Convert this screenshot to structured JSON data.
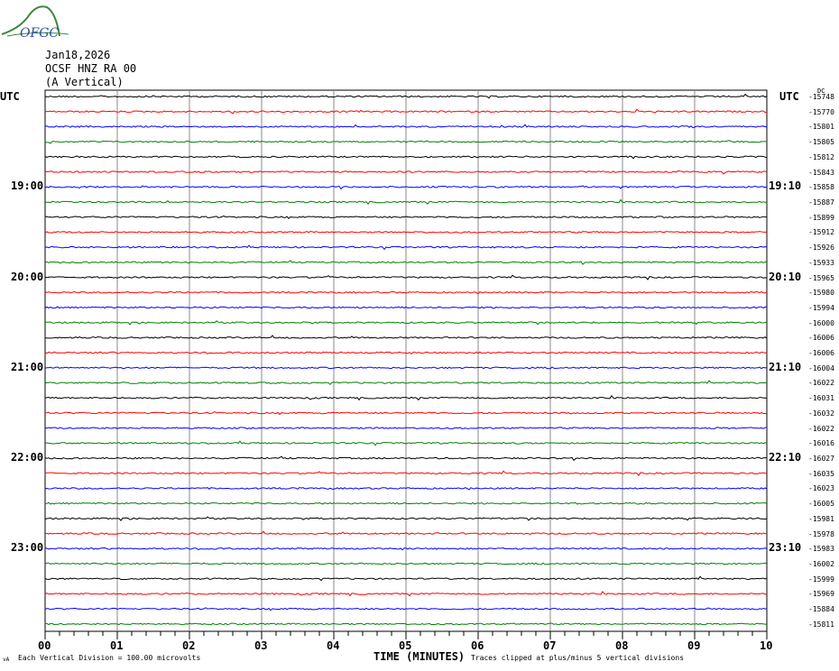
{
  "logo": {
    "text": "OFGC",
    "color": "#3a7a3a"
  },
  "header": {
    "date": "Jan18,2026",
    "station": "OCSF HNZ RA 00",
    "component": "(A Vertical)"
  },
  "left_top_label": "UTC",
  "right_top_label": "UTC",
  "dc_label": "DC",
  "footer": {
    "scale": "Each Vertical Division =  100.00 microvolts",
    "xlabel": "TIME (MINUTES)",
    "clip": "Traces clipped at plus/minus 5 vertical divisions",
    "corner": "vA"
  },
  "chart_data": {
    "type": "line",
    "title": "OCSF HNZ RA 00 (A Vertical) Jan18,2026",
    "xlabel": "TIME (MINUTES)",
    "xlim": [
      0,
      10
    ],
    "x_ticks": [
      "00",
      "01",
      "02",
      "03",
      "04",
      "05",
      "06",
      "07",
      "08",
      "09",
      "10"
    ],
    "trace_minutes": 10,
    "trace_colors": [
      "#000000",
      "#ff0000",
      "#0000ff",
      "#008000"
    ],
    "left_hour_labels": [
      {
        "trace": 6,
        "label": "19:00"
      },
      {
        "trace": 12,
        "label": "20:00"
      },
      {
        "trace": 18,
        "label": "21:00"
      },
      {
        "trace": 24,
        "label": "22:00"
      },
      {
        "trace": 30,
        "label": "23:00"
      }
    ],
    "right_hour_labels": [
      {
        "trace": 6,
        "label": "19:10"
      },
      {
        "trace": 12,
        "label": "20:10"
      },
      {
        "trace": 18,
        "label": "21:10"
      },
      {
        "trace": 24,
        "label": "22:10"
      },
      {
        "trace": 30,
        "label": "23:10"
      }
    ],
    "dc_offsets": [
      "-15748",
      "-15770",
      "-15801",
      "-15805",
      "-15812",
      "-15843",
      "-15858",
      "-15887",
      "-15899",
      "-15912",
      "-15926",
      "-15933",
      "-15965",
      "-15980",
      "-15994",
      "-16000",
      "-16006",
      "-16006",
      "-16004",
      "-16022",
      "-16031",
      "-16032",
      "-16022",
      "-16016",
      "-16027",
      "-16035",
      "-16023",
      "-16005",
      "-15981",
      "-15978",
      "-15983",
      "-16002",
      "-15999",
      "-15969",
      "-15884",
      "-15811"
    ],
    "units": "microvolts per vertical division: 100.00",
    "clip_divisions": 5
  }
}
